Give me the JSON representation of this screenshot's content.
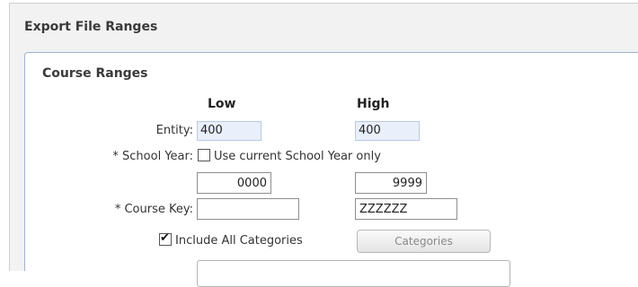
{
  "panel": {
    "title": "Export File Ranges"
  },
  "section": {
    "title": "Course Ranges",
    "low_header": "Low",
    "high_header": "High"
  },
  "entity": {
    "label": "Entity:",
    "low": "400",
    "high": "400"
  },
  "school_year": {
    "label": "* School Year:",
    "checkbox_label": "Use current School Year only",
    "checked": false,
    "low": "0000",
    "high": "9999"
  },
  "course_key": {
    "label": "* Course Key:",
    "low": "",
    "high": "ZZZZZZ"
  },
  "include_categories": {
    "label": "Include All Categories",
    "checked": true
  },
  "categories_button": {
    "label": "Categories"
  },
  "colors": {
    "panel_bg": "#f2f2f2",
    "section_border": "#9fb4cc",
    "readonly_bg": "#e9f0fb"
  }
}
